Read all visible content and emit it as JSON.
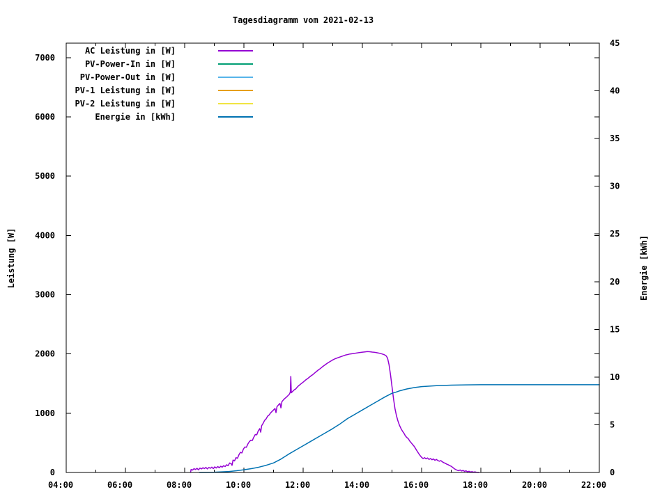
{
  "title": "Tagesdiagramm vom 2021-02-13",
  "axes": {
    "x": {
      "tick_labels": [
        "04:00",
        "06:00",
        "08:00",
        "10:00",
        "12:00",
        "14:00",
        "16:00",
        "18:00",
        "20:00",
        "22:00"
      ],
      "minor_tick_hours": [
        5,
        7,
        9,
        11,
        13,
        15,
        17,
        19,
        21
      ]
    },
    "y_left": {
      "label": "Leistung [W]",
      "tick_labels": [
        "0",
        "1000",
        "2000",
        "3000",
        "4000",
        "5000",
        "6000",
        "7000"
      ]
    },
    "y_right": {
      "label": "Energie [kWh]",
      "tick_labels": [
        "0",
        "5",
        "10",
        "15",
        "20",
        "25",
        "30",
        "35",
        "40",
        "45"
      ]
    }
  },
  "chart_data": {
    "type": "line",
    "title": "Tagesdiagramm vom 2021-02-13",
    "x_range": [
      "04:00",
      "22:00"
    ],
    "y_left_axis": {
      "label": "Leistung [W]",
      "range": [
        0,
        7246
      ],
      "ticks": [
        0,
        1000,
        2000,
        3000,
        4000,
        5000,
        6000,
        7000
      ]
    },
    "y_right_axis": {
      "label": "Energie [kWh]",
      "range": [
        0,
        45
      ],
      "ticks": [
        0,
        5,
        10,
        15,
        20,
        25,
        30,
        35,
        40,
        45
      ]
    },
    "grid": false,
    "legend_position": "inside-top-left",
    "series": [
      {
        "name": "AC Leistung in [W]",
        "color": "#9400d3",
        "axis": "left",
        "points": [
          [
            "08:12",
            5
          ],
          [
            "08:13",
            50
          ],
          [
            "08:16",
            40
          ],
          [
            "08:19",
            65
          ],
          [
            "08:22",
            50
          ],
          [
            "08:25",
            70
          ],
          [
            "08:28",
            45
          ],
          [
            "08:31",
            75
          ],
          [
            "08:34",
            60
          ],
          [
            "08:37",
            80
          ],
          [
            "08:40",
            65
          ],
          [
            "08:43",
            85
          ],
          [
            "08:46",
            60
          ],
          [
            "08:49",
            85
          ],
          [
            "08:52",
            70
          ],
          [
            "08:55",
            90
          ],
          [
            "08:58",
            65
          ],
          [
            "09:01",
            95
          ],
          [
            "09:04",
            75
          ],
          [
            "09:07",
            100
          ],
          [
            "09:10",
            80
          ],
          [
            "09:13",
            105
          ],
          [
            "09:16",
            90
          ],
          [
            "09:19",
            115
          ],
          [
            "09:22",
            100
          ],
          [
            "09:25",
            130
          ],
          [
            "09:28",
            115
          ],
          [
            "09:31",
            160
          ],
          [
            "09:34",
            150
          ],
          [
            "09:36",
            120
          ],
          [
            "09:38",
            210
          ],
          [
            "09:41",
            195
          ],
          [
            "09:44",
            250
          ],
          [
            "09:47",
            240
          ],
          [
            "09:50",
            300
          ],
          [
            "09:53",
            340
          ],
          [
            "09:56",
            330
          ],
          [
            "09:59",
            395
          ],
          [
            "10:02",
            430
          ],
          [
            "10:05",
            425
          ],
          [
            "10:08",
            480
          ],
          [
            "10:11",
            520
          ],
          [
            "10:14",
            545
          ],
          [
            "10:17",
            540
          ],
          [
            "10:20",
            595
          ],
          [
            "10:23",
            640
          ],
          [
            "10:26",
            635
          ],
          [
            "10:29",
            700
          ],
          [
            "10:32",
            740
          ],
          [
            "10:34",
            680
          ],
          [
            "10:36",
            790
          ],
          [
            "10:39",
            830
          ],
          [
            "10:42",
            880
          ],
          [
            "10:45",
            905
          ],
          [
            "10:48",
            950
          ],
          [
            "10:51",
            970
          ],
          [
            "10:54",
            1005
          ],
          [
            "10:57",
            1030
          ],
          [
            "11:00",
            1055
          ],
          [
            "11:03",
            1080
          ],
          [
            "11:05",
            1010
          ],
          [
            "11:07",
            1110
          ],
          [
            "11:10",
            1140
          ],
          [
            "11:13",
            1165
          ],
          [
            "11:15",
            1090
          ],
          [
            "11:17",
            1195
          ],
          [
            "11:20",
            1225
          ],
          [
            "11:23",
            1250
          ],
          [
            "11:26",
            1270
          ],
          [
            "11:29",
            1295
          ],
          [
            "11:32",
            1320
          ],
          [
            "11:34",
            1355
          ],
          [
            "11:35",
            1620
          ],
          [
            "11:36",
            1345
          ],
          [
            "11:39",
            1370
          ],
          [
            "11:42",
            1395
          ],
          [
            "11:45",
            1410
          ],
          [
            "11:48",
            1440
          ],
          [
            "11:51",
            1465
          ],
          [
            "11:54",
            1485
          ],
          [
            "11:57",
            1505
          ],
          [
            "12:00",
            1525
          ],
          [
            "12:05",
            1560
          ],
          [
            "12:10",
            1590
          ],
          [
            "12:15",
            1625
          ],
          [
            "12:20",
            1655
          ],
          [
            "12:25",
            1690
          ],
          [
            "12:30",
            1725
          ],
          [
            "12:35",
            1755
          ],
          [
            "12:40",
            1790
          ],
          [
            "12:45",
            1820
          ],
          [
            "12:50",
            1850
          ],
          [
            "12:55",
            1875
          ],
          [
            "13:00",
            1900
          ],
          [
            "13:05",
            1920
          ],
          [
            "13:10",
            1935
          ],
          [
            "13:15",
            1950
          ],
          [
            "13:20",
            1965
          ],
          [
            "13:25",
            1980
          ],
          [
            "13:30",
            1990
          ],
          [
            "13:35",
            2000
          ],
          [
            "13:40",
            2005
          ],
          [
            "13:45",
            2012
          ],
          [
            "13:50",
            2018
          ],
          [
            "13:55",
            2025
          ],
          [
            "14:00",
            2030
          ],
          [
            "14:05",
            2035
          ],
          [
            "14:10",
            2040
          ],
          [
            "14:15",
            2038
          ],
          [
            "14:20",
            2032
          ],
          [
            "14:25",
            2028
          ],
          [
            "14:30",
            2020
          ],
          [
            "14:35",
            2012
          ],
          [
            "14:40",
            2000
          ],
          [
            "14:45",
            1985
          ],
          [
            "14:48",
            1970
          ],
          [
            "14:51",
            1930
          ],
          [
            "14:54",
            1820
          ],
          [
            "14:57",
            1650
          ],
          [
            "15:00",
            1450
          ],
          [
            "15:03",
            1250
          ],
          [
            "15:06",
            1080
          ],
          [
            "15:09",
            960
          ],
          [
            "15:12",
            870
          ],
          [
            "15:15",
            800
          ],
          [
            "15:18",
            745
          ],
          [
            "15:21",
            700
          ],
          [
            "15:24",
            665
          ],
          [
            "15:27",
            620
          ],
          [
            "15:30",
            590
          ],
          [
            "15:33",
            570
          ],
          [
            "15:36",
            530
          ],
          [
            "15:39",
            500
          ],
          [
            "15:42",
            470
          ],
          [
            "15:45",
            440
          ],
          [
            "15:48",
            400
          ],
          [
            "15:51",
            360
          ],
          [
            "15:54",
            320
          ],
          [
            "15:57",
            285
          ],
          [
            "16:00",
            255
          ],
          [
            "16:03",
            235
          ],
          [
            "16:06",
            250
          ],
          [
            "16:09",
            230
          ],
          [
            "16:12",
            245
          ],
          [
            "16:15",
            220
          ],
          [
            "16:18",
            235
          ],
          [
            "16:21",
            215
          ],
          [
            "16:24",
            228
          ],
          [
            "16:27",
            205
          ],
          [
            "16:30",
            220
          ],
          [
            "16:33",
            200
          ],
          [
            "16:36",
            190
          ],
          [
            "16:39",
            200
          ],
          [
            "16:42",
            180
          ],
          [
            "16:45",
            165
          ],
          [
            "16:48",
            155
          ],
          [
            "16:51",
            140
          ],
          [
            "16:54",
            130
          ],
          [
            "16:57",
            115
          ],
          [
            "17:00",
            105
          ],
          [
            "17:03",
            85
          ],
          [
            "17:06",
            65
          ],
          [
            "17:09",
            50
          ],
          [
            "17:12",
            38
          ],
          [
            "17:15",
            30
          ],
          [
            "17:18",
            42
          ],
          [
            "17:21",
            25
          ],
          [
            "17:24",
            35
          ],
          [
            "17:27",
            18
          ],
          [
            "17:30",
            28
          ],
          [
            "17:33",
            12
          ],
          [
            "17:36",
            20
          ],
          [
            "17:39",
            8
          ],
          [
            "17:42",
            14
          ],
          [
            "17:45",
            5
          ],
          [
            "17:48",
            10
          ],
          [
            "17:51",
            3
          ],
          [
            "17:56",
            0
          ]
        ]
      },
      {
        "name": "PV-Power-In in [W]",
        "color": "#009e73",
        "axis": "left",
        "points": []
      },
      {
        "name": "PV-Power-Out in [W]",
        "color": "#56b4e9",
        "axis": "left",
        "points": []
      },
      {
        "name": "PV-1 Leistung in [W]",
        "color": "#e69f00",
        "axis": "left",
        "points": []
      },
      {
        "name": "PV-2 Leistung in [W]",
        "color": "#f0e442",
        "axis": "left",
        "points": []
      },
      {
        "name": "Energie in [kWh]",
        "color": "#0072b2",
        "axis": "right",
        "points": [
          [
            "08:30",
            0
          ],
          [
            "09:00",
            0.03
          ],
          [
            "09:30",
            0.1
          ],
          [
            "09:45",
            0.18
          ],
          [
            "10:00",
            0.28
          ],
          [
            "10:15",
            0.4
          ],
          [
            "10:30",
            0.55
          ],
          [
            "10:45",
            0.75
          ],
          [
            "11:00",
            1.0
          ],
          [
            "11:15",
            1.4
          ],
          [
            "11:30",
            1.9
          ],
          [
            "11:45",
            2.35
          ],
          [
            "12:00",
            2.8
          ],
          [
            "12:15",
            3.25
          ],
          [
            "12:30",
            3.7
          ],
          [
            "12:45",
            4.15
          ],
          [
            "13:00",
            4.6
          ],
          [
            "13:15",
            5.1
          ],
          [
            "13:30",
            5.65
          ],
          [
            "13:45",
            6.1
          ],
          [
            "14:00",
            6.55
          ],
          [
            "14:15",
            7.0
          ],
          [
            "14:30",
            7.45
          ],
          [
            "14:45",
            7.9
          ],
          [
            "15:00",
            8.3
          ],
          [
            "15:08",
            8.42
          ],
          [
            "15:15",
            8.55
          ],
          [
            "15:30",
            8.75
          ],
          [
            "15:45",
            8.9
          ],
          [
            "16:00",
            9.0
          ],
          [
            "16:30",
            9.1
          ],
          [
            "17:00",
            9.15
          ],
          [
            "17:30",
            9.18
          ],
          [
            "18:00",
            9.2
          ],
          [
            "22:00",
            9.2
          ]
        ]
      }
    ]
  }
}
